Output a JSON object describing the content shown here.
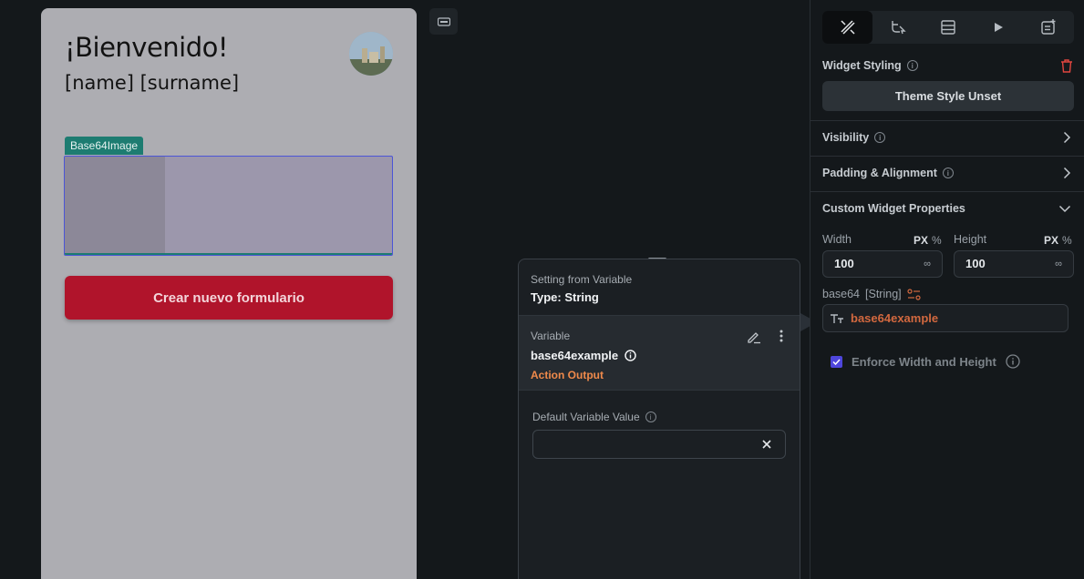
{
  "canvas": {
    "welcome_title": "¡Bienvenido!",
    "name_line": "[name] [surname]",
    "widget_tag": "Base64Image",
    "cta_button": "Crear nuevo formulario"
  },
  "variable_panel": {
    "heading": "Setting from Variable",
    "type_label": "Type: String",
    "variable_label": "Variable",
    "variable_name": "base64example",
    "variable_source": "Action Output",
    "default_label": "Default Variable Value",
    "default_value": ""
  },
  "properties": {
    "tabs": [
      "properties-icon",
      "actions-icon",
      "backend-query-icon",
      "preview-icon",
      "add-note-icon"
    ],
    "widget_styling_label": "Widget Styling",
    "theme_button": "Theme Style Unset",
    "visibility_label": "Visibility",
    "padding_label": "Padding & Alignment",
    "custom_props_label": "Custom Widget Properties",
    "width_label": "Width",
    "height_label": "Height",
    "unit_px": "PX",
    "unit_pct": "%",
    "width_value": "100",
    "height_value": "100",
    "infinity": "∞",
    "base64_label": "base64",
    "base64_type": "[String]",
    "base64_value": "base64example",
    "enforce_label": "Enforce Width and Height"
  },
  "colors": {
    "accent": "#4e46dc",
    "cta": "#b0142b",
    "variable_value": "#d2683f",
    "action_output": "#f08a4b",
    "delete": "#e0453f"
  }
}
